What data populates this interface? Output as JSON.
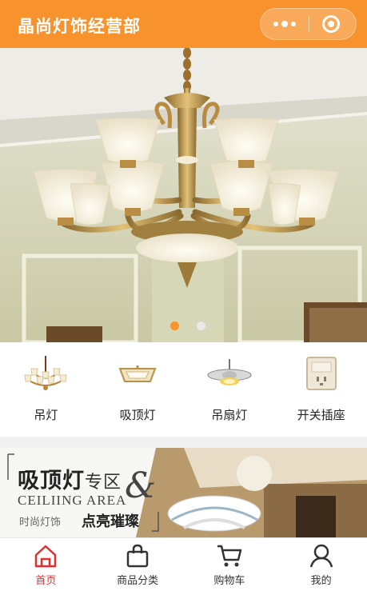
{
  "header": {
    "title": "晶尚灯饰经营部"
  },
  "colors": {
    "accent": "#f7922c",
    "active_tab": "#e32e2e"
  },
  "banner": {
    "slide_count": 2,
    "active_index": 0
  },
  "categories": [
    {
      "label": "吊灯",
      "icon": "chandelier-icon"
    },
    {
      "label": "吸顶灯",
      "icon": "ceiling-light-icon"
    },
    {
      "label": "吊扇灯",
      "icon": "fan-light-icon"
    },
    {
      "label": "开关插座",
      "icon": "switch-socket-icon"
    }
  ],
  "promo": {
    "title_main": "吸顶灯",
    "title_suffix": "专区",
    "amp": "&",
    "english": "CEILIING AREA",
    "sub1": "时尚灯饰",
    "sub2": "点亮璀璨"
  },
  "tabbar": [
    {
      "label": "首页",
      "icon": "home-icon",
      "active": true
    },
    {
      "label": "商品分类",
      "icon": "bag-icon",
      "active": false
    },
    {
      "label": "购物车",
      "icon": "cart-icon",
      "active": false
    },
    {
      "label": "我的",
      "icon": "user-icon",
      "active": false
    }
  ]
}
